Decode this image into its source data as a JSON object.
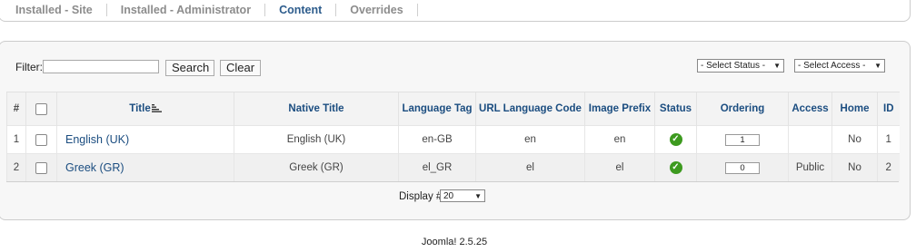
{
  "submenu": {
    "tabs": [
      {
        "label": "Installed - Site"
      },
      {
        "label": "Installed - Administrator"
      },
      {
        "label": "Content"
      },
      {
        "label": "Overrides"
      }
    ],
    "active_tab": "Content"
  },
  "filter": {
    "label": "Filter:",
    "value": "",
    "search_label": "Search",
    "clear_label": "Clear",
    "status_select": "- Select Status -",
    "access_select": "- Select Access -"
  },
  "table": {
    "headers": [
      "#",
      "",
      "Title",
      "Native Title",
      "Language Tag",
      "URL Language Code",
      "Image Prefix",
      "Status",
      "Ordering",
      "Access",
      "Home",
      "ID"
    ],
    "rows": [
      {
        "num": "1",
        "title": "English (UK)",
        "native": "English (UK)",
        "tag": "en-GB",
        "url_code": "en",
        "image_prefix": "en",
        "status": "published",
        "ordering": "1",
        "access": "",
        "home": "No",
        "id": "1"
      },
      {
        "num": "2",
        "title": "Greek (GR)",
        "native": "Greek (GR)",
        "tag": "el_GR",
        "url_code": "el",
        "image_prefix": "el",
        "status": "published",
        "ordering": "0",
        "access": "Public",
        "home": "No",
        "id": "2"
      }
    ],
    "display_label": "Display #",
    "display_value": "20"
  },
  "footer": {
    "text": "Joomla! 2.5.25"
  },
  "colors": {
    "link": "#1b4d80",
    "status_published": "#3d9a1f"
  }
}
